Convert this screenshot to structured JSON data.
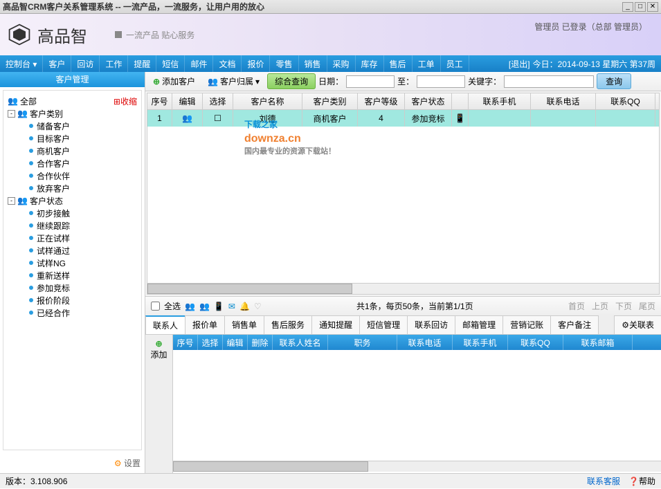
{
  "titlebar": "高品智CRM客户关系管理系统 -- 一流产品，一流服务，让用户用的放心",
  "logo_text": "高品智",
  "slogan": "一流产品 贴心服务",
  "user_info": "管理员  已登录（总部  管理员）",
  "menubar": {
    "items": [
      "控制台",
      "客户",
      "回访",
      "工作",
      "提醒",
      "短信",
      "邮件",
      "文档",
      "报价",
      "零售",
      "销售",
      "采购",
      "库存",
      "售后",
      "工单",
      "员工"
    ],
    "logout": "[退出]",
    "today": "今日：2014-09-13 星期六 第37周"
  },
  "sidebar": {
    "title": "客户管理",
    "collapse": "收缩",
    "root": "全部",
    "group1": {
      "label": "客户类别",
      "items": [
        "储备客户",
        "目标客户",
        "商机客户",
        "合作客户",
        "合作伙伴",
        "放弃客户"
      ]
    },
    "group2": {
      "label": "客户状态",
      "items": [
        "初步接触",
        "继续跟踪",
        "正在试样",
        "试样通过",
        "试样NG",
        "重新送样",
        "参加竞标",
        "报价阶段",
        "已经合作"
      ]
    },
    "settings": "设置"
  },
  "toolbar": {
    "add": "添加客户",
    "belong": "客户归属",
    "query": "综合查询",
    "date_label": "日期：",
    "to": "至：",
    "keyword": "关键字：",
    "search": "查询"
  },
  "grid": {
    "headers": [
      "序号",
      "编辑",
      "选择",
      "客户名称",
      "客户类别",
      "客户等级",
      "客户状态",
      "",
      "联系手机",
      "联系电话",
      "联系QQ"
    ],
    "widths": [
      36,
      44,
      44,
      100,
      80,
      68,
      68,
      24,
      90,
      94,
      86
    ],
    "row": {
      "seq": "1",
      "name": "刘德",
      "category": "商机客户",
      "grade": "4",
      "status": "参加竞标"
    }
  },
  "watermark": {
    "big": "下载之家",
    "domain": "downza.cn",
    "tag": "国内最专业的资源下载站！"
  },
  "pager": {
    "selectall": "全选",
    "info": "共1条，每页50条，当前第1/1页",
    "nav": [
      "首页",
      "上页",
      "下页",
      "尾页"
    ]
  },
  "tabs": [
    "联系人",
    "报价单",
    "销售单",
    "售后服务",
    "通知提醒",
    "短信管理",
    "联系回访",
    "邮箱管理",
    "营销记账",
    "客户备注"
  ],
  "related_table": "关联表",
  "sub_side": "添加",
  "sub_headers": [
    "序号",
    "选择",
    "编辑",
    "删除",
    "联系人姓名",
    "职务",
    "联系电话",
    "联系手机",
    "联系QQ",
    "联系邮箱"
  ],
  "sub_widths": [
    36,
    36,
    36,
    36,
    80,
    100,
    80,
    80,
    80,
    100
  ],
  "footer": {
    "version": "版本：3.108.906",
    "service": "联系客服",
    "help": "帮助"
  }
}
